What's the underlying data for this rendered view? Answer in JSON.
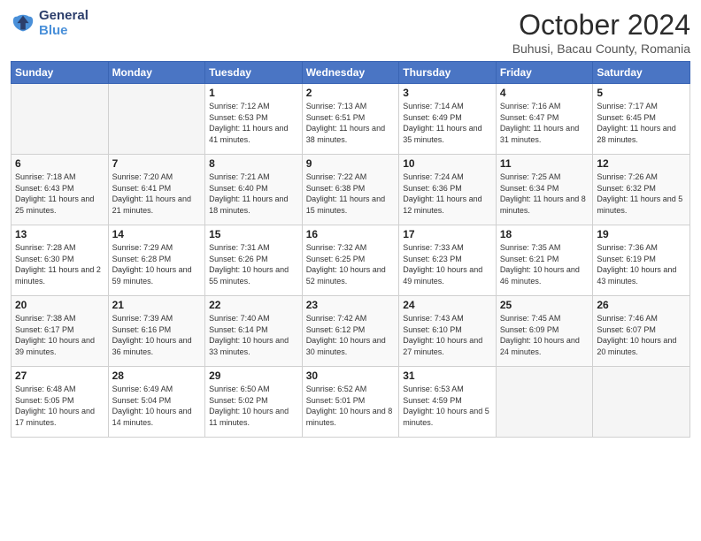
{
  "logo": {
    "general": "General",
    "blue": "Blue"
  },
  "title": "October 2024",
  "subtitle": "Buhusi, Bacau County, Romania",
  "weekdays": [
    "Sunday",
    "Monday",
    "Tuesday",
    "Wednesday",
    "Thursday",
    "Friday",
    "Saturday"
  ],
  "weeks": [
    [
      {
        "day": "",
        "info": ""
      },
      {
        "day": "",
        "info": ""
      },
      {
        "day": "1",
        "info": "Sunrise: 7:12 AM\nSunset: 6:53 PM\nDaylight: 11 hours and 41 minutes."
      },
      {
        "day": "2",
        "info": "Sunrise: 7:13 AM\nSunset: 6:51 PM\nDaylight: 11 hours and 38 minutes."
      },
      {
        "day": "3",
        "info": "Sunrise: 7:14 AM\nSunset: 6:49 PM\nDaylight: 11 hours and 35 minutes."
      },
      {
        "day": "4",
        "info": "Sunrise: 7:16 AM\nSunset: 6:47 PM\nDaylight: 11 hours and 31 minutes."
      },
      {
        "day": "5",
        "info": "Sunrise: 7:17 AM\nSunset: 6:45 PM\nDaylight: 11 hours and 28 minutes."
      }
    ],
    [
      {
        "day": "6",
        "info": "Sunrise: 7:18 AM\nSunset: 6:43 PM\nDaylight: 11 hours and 25 minutes."
      },
      {
        "day": "7",
        "info": "Sunrise: 7:20 AM\nSunset: 6:41 PM\nDaylight: 11 hours and 21 minutes."
      },
      {
        "day": "8",
        "info": "Sunrise: 7:21 AM\nSunset: 6:40 PM\nDaylight: 11 hours and 18 minutes."
      },
      {
        "day": "9",
        "info": "Sunrise: 7:22 AM\nSunset: 6:38 PM\nDaylight: 11 hours and 15 minutes."
      },
      {
        "day": "10",
        "info": "Sunrise: 7:24 AM\nSunset: 6:36 PM\nDaylight: 11 hours and 12 minutes."
      },
      {
        "day": "11",
        "info": "Sunrise: 7:25 AM\nSunset: 6:34 PM\nDaylight: 11 hours and 8 minutes."
      },
      {
        "day": "12",
        "info": "Sunrise: 7:26 AM\nSunset: 6:32 PM\nDaylight: 11 hours and 5 minutes."
      }
    ],
    [
      {
        "day": "13",
        "info": "Sunrise: 7:28 AM\nSunset: 6:30 PM\nDaylight: 11 hours and 2 minutes."
      },
      {
        "day": "14",
        "info": "Sunrise: 7:29 AM\nSunset: 6:28 PM\nDaylight: 10 hours and 59 minutes."
      },
      {
        "day": "15",
        "info": "Sunrise: 7:31 AM\nSunset: 6:26 PM\nDaylight: 10 hours and 55 minutes."
      },
      {
        "day": "16",
        "info": "Sunrise: 7:32 AM\nSunset: 6:25 PM\nDaylight: 10 hours and 52 minutes."
      },
      {
        "day": "17",
        "info": "Sunrise: 7:33 AM\nSunset: 6:23 PM\nDaylight: 10 hours and 49 minutes."
      },
      {
        "day": "18",
        "info": "Sunrise: 7:35 AM\nSunset: 6:21 PM\nDaylight: 10 hours and 46 minutes."
      },
      {
        "day": "19",
        "info": "Sunrise: 7:36 AM\nSunset: 6:19 PM\nDaylight: 10 hours and 43 minutes."
      }
    ],
    [
      {
        "day": "20",
        "info": "Sunrise: 7:38 AM\nSunset: 6:17 PM\nDaylight: 10 hours and 39 minutes."
      },
      {
        "day": "21",
        "info": "Sunrise: 7:39 AM\nSunset: 6:16 PM\nDaylight: 10 hours and 36 minutes."
      },
      {
        "day": "22",
        "info": "Sunrise: 7:40 AM\nSunset: 6:14 PM\nDaylight: 10 hours and 33 minutes."
      },
      {
        "day": "23",
        "info": "Sunrise: 7:42 AM\nSunset: 6:12 PM\nDaylight: 10 hours and 30 minutes."
      },
      {
        "day": "24",
        "info": "Sunrise: 7:43 AM\nSunset: 6:10 PM\nDaylight: 10 hours and 27 minutes."
      },
      {
        "day": "25",
        "info": "Sunrise: 7:45 AM\nSunset: 6:09 PM\nDaylight: 10 hours and 24 minutes."
      },
      {
        "day": "26",
        "info": "Sunrise: 7:46 AM\nSunset: 6:07 PM\nDaylight: 10 hours and 20 minutes."
      }
    ],
    [
      {
        "day": "27",
        "info": "Sunrise: 6:48 AM\nSunset: 5:05 PM\nDaylight: 10 hours and 17 minutes."
      },
      {
        "day": "28",
        "info": "Sunrise: 6:49 AM\nSunset: 5:04 PM\nDaylight: 10 hours and 14 minutes."
      },
      {
        "day": "29",
        "info": "Sunrise: 6:50 AM\nSunset: 5:02 PM\nDaylight: 10 hours and 11 minutes."
      },
      {
        "day": "30",
        "info": "Sunrise: 6:52 AM\nSunset: 5:01 PM\nDaylight: 10 hours and 8 minutes."
      },
      {
        "day": "31",
        "info": "Sunrise: 6:53 AM\nSunset: 4:59 PM\nDaylight: 10 hours and 5 minutes."
      },
      {
        "day": "",
        "info": ""
      },
      {
        "day": "",
        "info": ""
      }
    ]
  ]
}
